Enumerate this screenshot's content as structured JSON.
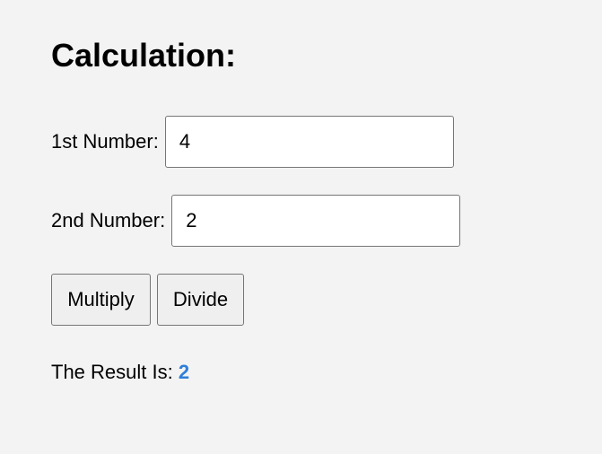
{
  "heading": "Calculation:",
  "first_number": {
    "label": "1st Number:",
    "value": "4"
  },
  "second_number": {
    "label": "2nd Number:",
    "value": "2"
  },
  "buttons": {
    "multiply": "Multiply",
    "divide": "Divide"
  },
  "result": {
    "label": "The Result Is: ",
    "value": "2",
    "value_color": "#2f7fd8"
  }
}
